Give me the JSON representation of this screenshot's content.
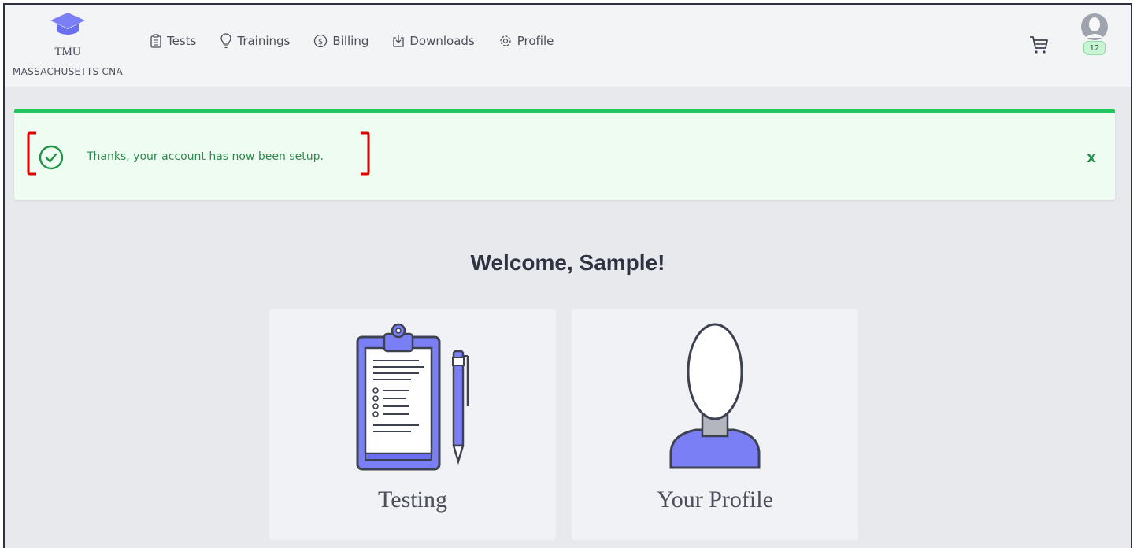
{
  "brand": {
    "name": "TMU",
    "subtitle": "MASSACHUSETTS CNA"
  },
  "nav": {
    "items": [
      {
        "label": "Tests",
        "icon": "clipboard-icon"
      },
      {
        "label": "Trainings",
        "icon": "lightbulb-icon"
      },
      {
        "label": "Billing",
        "icon": "dollar-circle-icon"
      },
      {
        "label": "Downloads",
        "icon": "download-icon"
      },
      {
        "label": "Profile",
        "icon": "gear-icon"
      }
    ]
  },
  "header": {
    "cart_icon": "cart-icon",
    "avatar_badge": "12"
  },
  "alert": {
    "message": "Thanks, your account has now been setup.",
    "close_label": "x"
  },
  "main": {
    "welcome": "Welcome, Sample!",
    "cards": [
      {
        "label": "Testing",
        "icon": "clipboard-pen-illustration"
      },
      {
        "label": "Your Profile",
        "icon": "person-illustration"
      }
    ]
  },
  "colors": {
    "accent": "#7b7ff5",
    "success": "#22c55e",
    "annotation": "#e00000"
  }
}
